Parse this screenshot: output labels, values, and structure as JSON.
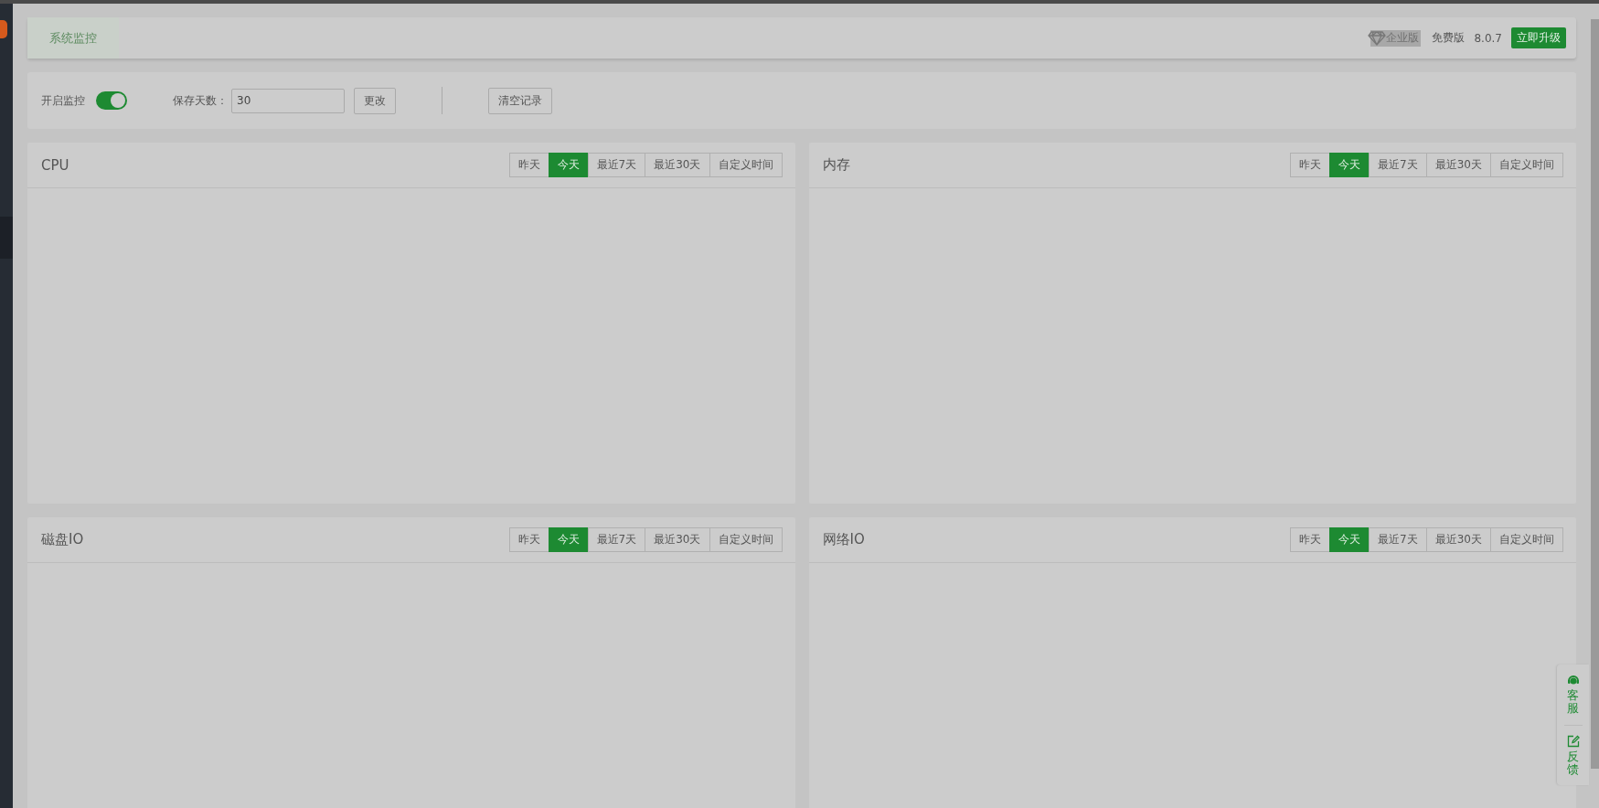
{
  "tabs": [
    {
      "label": "系统监控",
      "selected": true
    }
  ],
  "header": {
    "edition_badge": "企业版",
    "edition": "免费版",
    "version": "8.0.7",
    "upgrade_button": "立即升级"
  },
  "controls": {
    "monitor_label": "开启监控",
    "monitor_on": true,
    "days_label": "保存天数：",
    "days_value": "30",
    "change_button": "更改",
    "clear_button": "清空记录"
  },
  "panels": [
    {
      "title": "CPU",
      "ranges": [
        {
          "label": "昨天",
          "selected": false
        },
        {
          "label": "今天",
          "selected": true
        },
        {
          "label": "最近7天",
          "selected": false
        },
        {
          "label": "最近30天",
          "selected": false
        },
        {
          "label": "自定义时间",
          "selected": false
        }
      ]
    },
    {
      "title": "内存",
      "ranges": [
        {
          "label": "昨天",
          "selected": false
        },
        {
          "label": "今天",
          "selected": true
        },
        {
          "label": "最近7天",
          "selected": false
        },
        {
          "label": "最近30天",
          "selected": false
        },
        {
          "label": "自定义时间",
          "selected": false
        }
      ]
    },
    {
      "title": "磁盘IO",
      "ranges": [
        {
          "label": "昨天",
          "selected": false
        },
        {
          "label": "今天",
          "selected": true
        },
        {
          "label": "最近7天",
          "selected": false
        },
        {
          "label": "最近30天",
          "selected": false
        },
        {
          "label": "自定义时间",
          "selected": false
        }
      ]
    },
    {
      "title": "网络IO",
      "ranges": [
        {
          "label": "昨天",
          "selected": false
        },
        {
          "label": "今天",
          "selected": true
        },
        {
          "label": "最近7天",
          "selected": false
        },
        {
          "label": "最近30天",
          "selected": false
        },
        {
          "label": "自定义时间",
          "selected": false
        }
      ]
    }
  ],
  "side_widget": [
    {
      "kind": "headset",
      "label": "客服"
    },
    {
      "kind": "edit",
      "label": "反馈"
    }
  ]
}
